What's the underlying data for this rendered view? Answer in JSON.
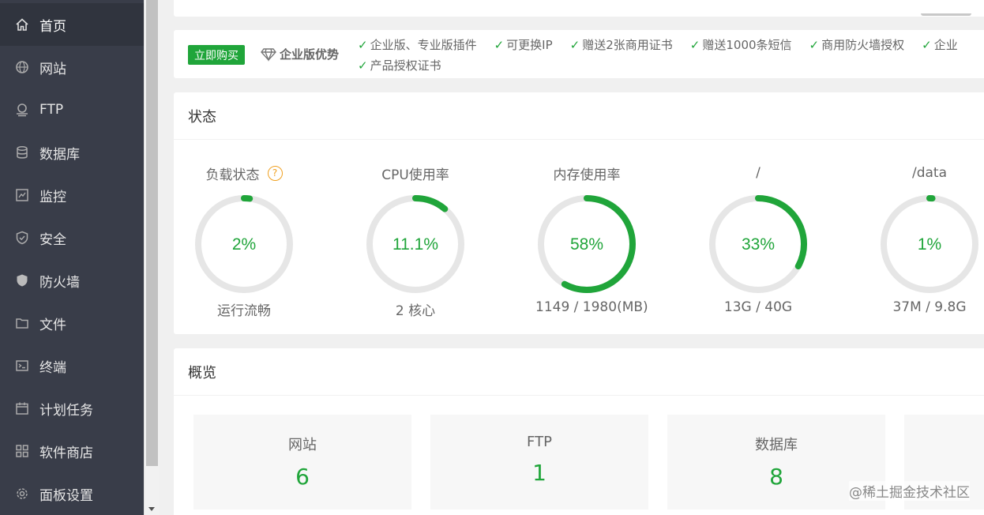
{
  "sidebar": {
    "items": [
      {
        "label": "首页",
        "icon": "home-icon",
        "active": true
      },
      {
        "label": "网站",
        "icon": "globe-icon"
      },
      {
        "label": "FTP",
        "icon": "ftp-icon"
      },
      {
        "label": "数据库",
        "icon": "database-icon"
      },
      {
        "label": "监控",
        "icon": "monitor-icon"
      },
      {
        "label": "安全",
        "icon": "shield-check-icon"
      },
      {
        "label": "防火墙",
        "icon": "shield-icon"
      },
      {
        "label": "文件",
        "icon": "folder-icon"
      },
      {
        "label": "终端",
        "icon": "terminal-icon"
      },
      {
        "label": "计划任务",
        "icon": "calendar-icon"
      },
      {
        "label": "软件商店",
        "icon": "apps-icon"
      },
      {
        "label": "面板设置",
        "icon": "gear-icon"
      }
    ]
  },
  "promo": {
    "buy_label": "立即购买",
    "title": "企业版优势",
    "features": [
      "企业版、专业版插件",
      "可更换IP",
      "赠送2张商用证书",
      "赠送1000条短信",
      "商用防火墙授权",
      "企业",
      "产品授权证书"
    ]
  },
  "status": {
    "title": "状态",
    "gauges": [
      {
        "title": "负载状态",
        "value": "2%",
        "percent": 2,
        "sub": "运行流畅",
        "help": "?"
      },
      {
        "title": "CPU使用率",
        "value": "11.1%",
        "percent": 11.1,
        "sub": "2 核心"
      },
      {
        "title": "内存使用率",
        "value": "58%",
        "percent": 58,
        "sub": "1149 / 1980(MB)"
      },
      {
        "title": "/",
        "value": "33%",
        "percent": 33,
        "sub": "13G / 40G"
      },
      {
        "title": "/data",
        "value": "1%",
        "percent": 1,
        "sub": "37M / 9.8G"
      }
    ]
  },
  "overview": {
    "title": "概览",
    "boxes": [
      {
        "label": "网站",
        "value": "6"
      },
      {
        "label": "FTP",
        "value": "1"
      },
      {
        "label": "数据库",
        "value": "8"
      }
    ]
  },
  "watermark": "@稀土掘金技术社区",
  "colors": {
    "accent": "#20a53a",
    "sidebar": "#393d49",
    "track": "#e6e6e6",
    "help": "#f0a020"
  }
}
